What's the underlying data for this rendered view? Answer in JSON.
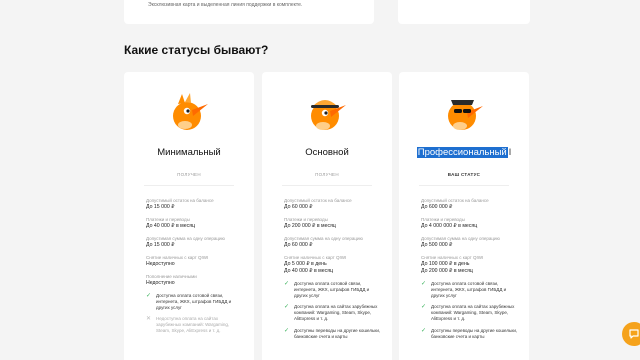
{
  "top_card": {
    "text": "Эксклюзивная карта и выделенная линия поддержки в комплекте."
  },
  "section_title": "Какие статусы бывают?",
  "cards": [
    {
      "title": "Минимальный",
      "status": "ПОЛУЧЕН",
      "rows": [
        {
          "label": "Допустимый остаток на балансе",
          "value": "До 15 000 ₽"
        },
        {
          "label": "Платежи и переводы",
          "value": "До 40 000 ₽ в месяц"
        },
        {
          "label": "Допустимая сумма на одну операцию",
          "value": "До 15 000 ₽"
        },
        {
          "label": "Снятие наличных с карт QIWI",
          "value": "Недоступно"
        },
        {
          "label": "Пополнение наличными",
          "value": "Недоступно"
        }
      ],
      "features": [
        {
          "text": "Доступна оплата сотовой связи, интернета, ЖКХ, штрафов ГИБДД и других услуг",
          "enabled": true
        },
        {
          "text": "Недоступна оплата на сайтах зарубежных компаний: Wargaming, Steam, Skype, AliExpress и т. д.",
          "enabled": false
        }
      ]
    },
    {
      "title": "Основной",
      "status": "ПОЛУЧЕН",
      "rows": [
        {
          "label": "Допустимый остаток на балансе",
          "value": "До 60 000 ₽"
        },
        {
          "label": "Платежи и переводы",
          "value": "До 200 000 ₽ в месяц"
        },
        {
          "label": "Допустимая сумма на одну операцию",
          "value": "До 60 000 ₽"
        },
        {
          "label": "Снятие наличных с карт QIWI",
          "value": "До 5 000 ₽ в день\nДо 40 000 ₽ в месяц"
        }
      ],
      "features": [
        {
          "text": "Доступна оплата сотовой связи, интернета, ЖКХ, штрафов ГИБДД и других услуг",
          "enabled": true
        },
        {
          "text": "Доступна оплата на сайтах зарубежных компаний: Wargaming, Steam, Skype, AliExpress и т. д.",
          "enabled": true
        },
        {
          "text": "Доступны переводы на другие кошельки, банковские счета и карты",
          "enabled": true
        }
      ]
    },
    {
      "title": "Профессиональный",
      "status": "ВАШ СТАТУС",
      "rows": [
        {
          "label": "Допустимый остаток на балансе",
          "value": "До 600 000 ₽"
        },
        {
          "label": "Платежи и переводы",
          "value": "До 4 000 000 ₽ в месяц"
        },
        {
          "label": "Допустимая сумма на одну операцию",
          "value": "До 500 000 ₽"
        },
        {
          "label": "Снятие наличных с карт QIWI",
          "value": "До 100 000 ₽ в день\nДо 200 000 ₽ в месяц"
        }
      ],
      "features": [
        {
          "text": "Доступна оплата сотовой связи, интернета, ЖКХ, штрафов ГИБДД и других услуг",
          "enabled": true
        },
        {
          "text": "Доступна оплата на сайтах зарубежных компаний: Wargaming, Steam, Skype, AliExpress и т. д.",
          "enabled": true
        },
        {
          "text": "Доступны переводы на другие кошельки, банковские счета и карты",
          "enabled": true
        }
      ]
    }
  ],
  "icons": {
    "check": "check-icon",
    "cross": "cross-icon",
    "chat": "chat-icon"
  },
  "colors": {
    "accent": "#ff8c00",
    "check": "#3bb25b",
    "selection": "#1e6fd0",
    "chat": "#f5a21b"
  }
}
